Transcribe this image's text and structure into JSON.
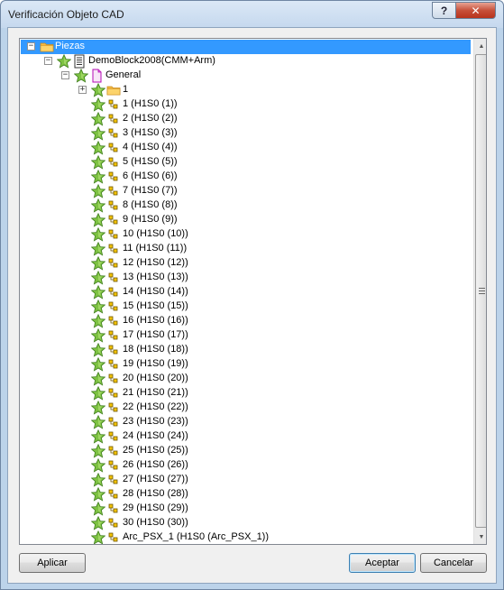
{
  "window": {
    "title": "Verificación Objeto CAD",
    "help_glyph": "?",
    "close_glyph": "✕"
  },
  "tree": {
    "rows": [
      {
        "level": 0,
        "expander": "minus",
        "icon": "folder-icon",
        "label": "Piezas",
        "selected": true
      },
      {
        "level": 1,
        "expander": "minus",
        "icon": "star-icon",
        "icon2": "document-icon",
        "label": "DemoBlock2008(CMM+Arm)"
      },
      {
        "level": 2,
        "expander": "minus",
        "icon": "star-icon",
        "icon2": "page-icon",
        "label": "General"
      },
      {
        "level": 3,
        "expander": "plus",
        "icon": "star-icon",
        "icon2": "folder-icon",
        "label": "1"
      },
      {
        "level": 3,
        "icon": "star-icon",
        "icon2": "feature-icon",
        "label": "1 (H1S0 (1))"
      },
      {
        "level": 3,
        "icon": "star-icon",
        "icon2": "feature-icon",
        "label": "2 (H1S0 (2))"
      },
      {
        "level": 3,
        "icon": "star-icon",
        "icon2": "feature-icon",
        "label": "3 (H1S0 (3))"
      },
      {
        "level": 3,
        "icon": "star-icon",
        "icon2": "feature-icon",
        "label": "4 (H1S0 (4))"
      },
      {
        "level": 3,
        "icon": "star-icon",
        "icon2": "feature-icon",
        "label": "5 (H1S0 (5))"
      },
      {
        "level": 3,
        "icon": "star-icon",
        "icon2": "feature-icon",
        "label": "6 (H1S0 (6))"
      },
      {
        "level": 3,
        "icon": "star-icon",
        "icon2": "feature-icon",
        "label": "7 (H1S0 (7))"
      },
      {
        "level": 3,
        "icon": "star-icon",
        "icon2": "feature-icon",
        "label": "8 (H1S0 (8))"
      },
      {
        "level": 3,
        "icon": "star-icon",
        "icon2": "feature-icon",
        "label": "9 (H1S0 (9))"
      },
      {
        "level": 3,
        "icon": "star-icon",
        "icon2": "feature-icon",
        "label": "10 (H1S0 (10))"
      },
      {
        "level": 3,
        "icon": "star-icon",
        "icon2": "feature-icon",
        "label": "11 (H1S0 (11))"
      },
      {
        "level": 3,
        "icon": "star-icon",
        "icon2": "feature-icon",
        "label": "12 (H1S0 (12))"
      },
      {
        "level": 3,
        "icon": "star-icon",
        "icon2": "feature-icon",
        "label": "13 (H1S0 (13))"
      },
      {
        "level": 3,
        "icon": "star-icon",
        "icon2": "feature-icon",
        "label": "14 (H1S0 (14))"
      },
      {
        "level": 3,
        "icon": "star-icon",
        "icon2": "feature-icon",
        "label": "15 (H1S0 (15))"
      },
      {
        "level": 3,
        "icon": "star-icon",
        "icon2": "feature-icon",
        "label": "16 (H1S0 (16))"
      },
      {
        "level": 3,
        "icon": "star-icon",
        "icon2": "feature-icon",
        "label": "17 (H1S0 (17))"
      },
      {
        "level": 3,
        "icon": "star-icon",
        "icon2": "feature-icon",
        "label": "18 (H1S0 (18))"
      },
      {
        "level": 3,
        "icon": "star-icon",
        "icon2": "feature-icon",
        "label": "19 (H1S0 (19))"
      },
      {
        "level": 3,
        "icon": "star-icon",
        "icon2": "feature-icon",
        "label": "20 (H1S0 (20))"
      },
      {
        "level": 3,
        "icon": "star-icon",
        "icon2": "feature-icon",
        "label": "21 (H1S0 (21))"
      },
      {
        "level": 3,
        "icon": "star-icon",
        "icon2": "feature-icon",
        "label": "22 (H1S0 (22))"
      },
      {
        "level": 3,
        "icon": "star-icon",
        "icon2": "feature-icon",
        "label": "23 (H1S0 (23))"
      },
      {
        "level": 3,
        "icon": "star-icon",
        "icon2": "feature-icon",
        "label": "24 (H1S0 (24))"
      },
      {
        "level": 3,
        "icon": "star-icon",
        "icon2": "feature-icon",
        "label": "25 (H1S0 (25))"
      },
      {
        "level": 3,
        "icon": "star-icon",
        "icon2": "feature-icon",
        "label": "26 (H1S0 (26))"
      },
      {
        "level": 3,
        "icon": "star-icon",
        "icon2": "feature-icon",
        "label": "27 (H1S0 (27))"
      },
      {
        "level": 3,
        "icon": "star-icon",
        "icon2": "feature-icon",
        "label": "28 (H1S0 (28))"
      },
      {
        "level": 3,
        "icon": "star-icon",
        "icon2": "feature-icon",
        "label": "29 (H1S0 (29))"
      },
      {
        "level": 3,
        "icon": "star-icon",
        "icon2": "feature-icon",
        "label": "30 (H1S0 (30))"
      },
      {
        "level": 3,
        "icon": "star-icon",
        "icon2": "feature-icon",
        "label": "Arc_PSX_1 (H1S0 (Arc_PSX_1))"
      }
    ]
  },
  "buttons": {
    "apply": "Aplicar",
    "ok": "Aceptar",
    "cancel": "Cancelar"
  },
  "colors": {
    "selection": "#3399ff",
    "star": "#7dc242",
    "folder": "#f5b942"
  }
}
